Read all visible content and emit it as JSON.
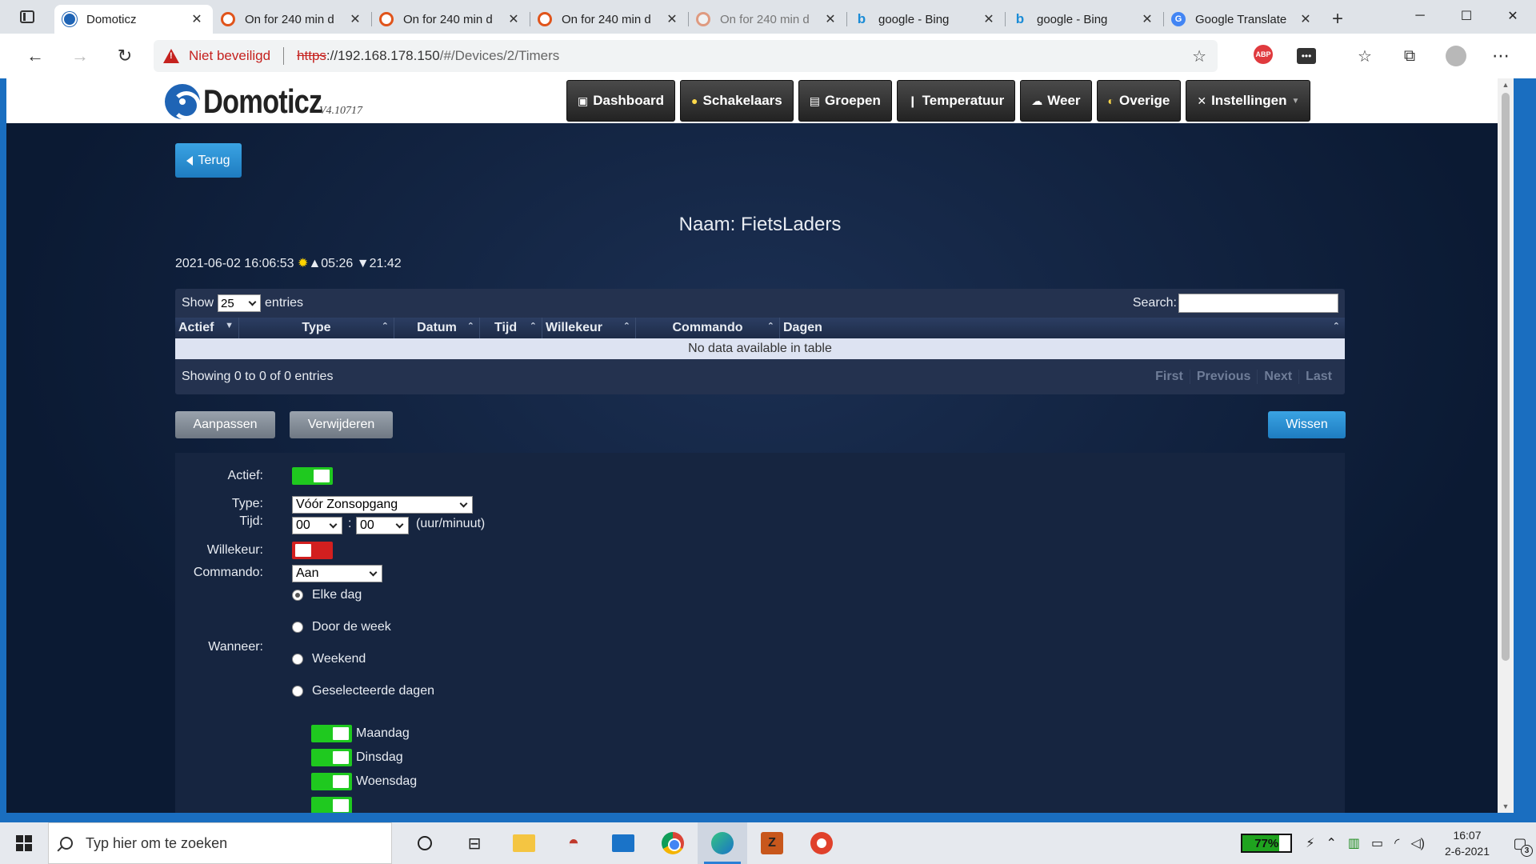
{
  "browser": {
    "tabs": [
      {
        "title": "Domoticz",
        "icon": "domoticz-icon",
        "active": true
      },
      {
        "title": "On for 240 min d",
        "icon": "domoticz-orange-icon"
      },
      {
        "title": "On for 240 min d",
        "icon": "domoticz-orange-icon"
      },
      {
        "title": "On for 240 min d",
        "icon": "domoticz-orange-icon"
      },
      {
        "title": "On for 240 min d",
        "icon": "domoticz-orange-icon"
      },
      {
        "title": "google - Bing",
        "icon": "bing-icon"
      },
      {
        "title": "google - Bing",
        "icon": "bing-icon"
      },
      {
        "title": "Google Translate",
        "icon": "google-translate-icon"
      }
    ],
    "security_label": "Niet beveiligd",
    "url_scheme": "https",
    "url_host": "://192.168.178.150",
    "url_path": "/#/Devices/2/Timers",
    "extension_abp": "ABP"
  },
  "app": {
    "logo_text": "Domoticz",
    "version": "V4.10717",
    "nav": [
      {
        "label": "Dashboard",
        "icon": "dashboard-icon"
      },
      {
        "label": "Schakelaars",
        "icon": "bulb-icon"
      },
      {
        "label": "Groepen",
        "icon": "scene-icon"
      },
      {
        "label": "Temperatuur",
        "icon": "thermometer-icon"
      },
      {
        "label": "Weer",
        "icon": "cloud-icon"
      },
      {
        "label": "Overige",
        "icon": "utility-icon"
      },
      {
        "label": "Instellingen",
        "icon": "tools-icon"
      }
    ]
  },
  "page": {
    "back_label": "Terug",
    "device_name": "Naam: FietsLaders",
    "datetime": "2021-06-02 16:06:53",
    "sunrise": "▲05:26",
    "sunset": "▼21:42"
  },
  "table": {
    "show_label": "Show",
    "entries_label": "entries",
    "page_size": "25",
    "search_label": "Search:",
    "columns": [
      "Actief",
      "Type",
      "Datum",
      "Tijd",
      "Willekeur",
      "Commando",
      "Dagen"
    ],
    "empty_text": "No data available in table",
    "info": "Showing 0 to 0 of 0 entries",
    "pager": [
      "First",
      "Previous",
      "Next",
      "Last"
    ]
  },
  "actions": {
    "edit": "Aanpassen",
    "delete": "Verwijderen",
    "clear": "Wissen"
  },
  "form": {
    "active_label": "Actief:",
    "active_value": true,
    "type_label": "Type:",
    "type_value": "Vóór Zonsopgang",
    "time_label": "Tijd:",
    "hour": "00",
    "minute": "00",
    "time_sep": ":",
    "time_unit": "(uur/minuut)",
    "random_label": "Willekeur:",
    "random_value": false,
    "command_label": "Commando:",
    "command_value": "Aan",
    "when_label": "Wanneer:",
    "when_options": [
      "Elke dag",
      "Door de week",
      "Weekend",
      "Geselecteerde dagen"
    ],
    "when_selected": 0,
    "days": [
      "Maandag",
      "Dinsdag",
      "Woensdag"
    ]
  },
  "taskbar": {
    "search_placeholder": "Typ hier om te zoeken",
    "battery": "77%",
    "time": "16:07",
    "date": "2-6-2021",
    "notifications": "3"
  }
}
